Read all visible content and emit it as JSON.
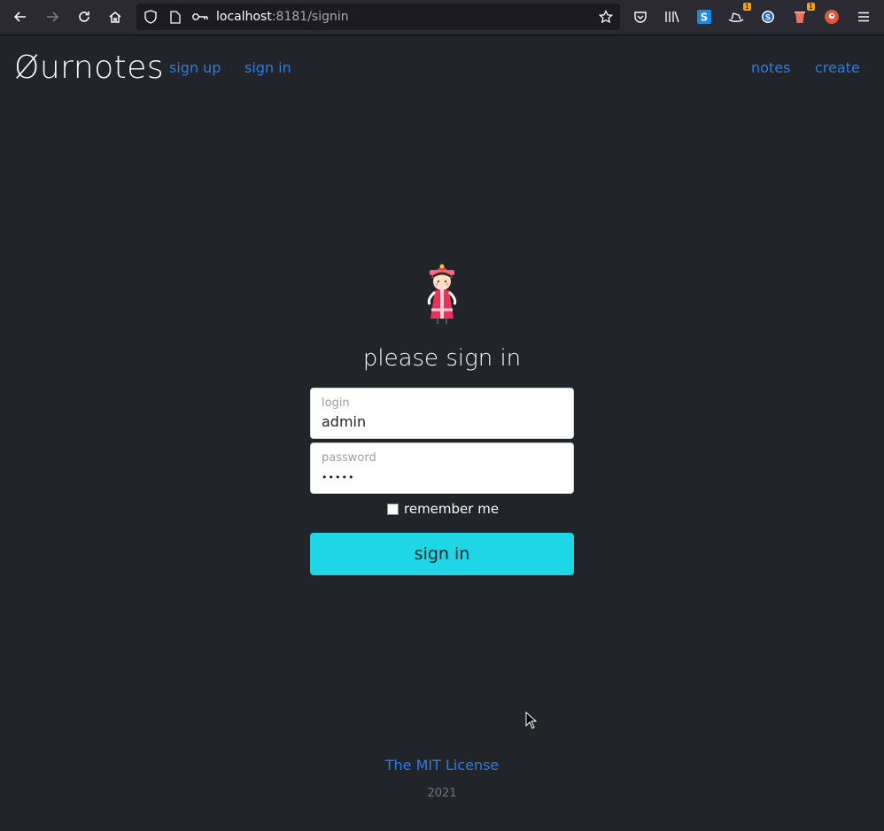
{
  "browser": {
    "url_host": "localhost",
    "url_rest": ":8181/signin",
    "toolbar_icons": [
      "back-arrow-icon",
      "forward-arrow-icon",
      "reload-icon",
      "home-icon",
      "shield-icon",
      "page-icon",
      "key-icon",
      "bookmark-star-icon",
      "pocket-icon",
      "library-icon",
      "extension-s-icon",
      "extension-hat-icon",
      "extension-circle-s-icon",
      "extension-cup-icon",
      "duckduckgo-icon",
      "menu-icon"
    ],
    "badges": [
      "1",
      "1"
    ]
  },
  "header": {
    "brand": "Øurnotes",
    "nav_left": [
      "sign up",
      "sign in"
    ],
    "nav_right": [
      "notes",
      "create"
    ]
  },
  "form": {
    "heading": "please sign in",
    "login_label": "login",
    "login_value": "admin",
    "password_label": "password",
    "password_value": "•••••",
    "remember_label": "remember me",
    "remember_checked": false,
    "submit_label": "sign in"
  },
  "footer": {
    "license": "The MIT License",
    "year": "2021"
  },
  "colors": {
    "background": "#212529",
    "link": "#2c7be5",
    "button": "#1ed6e6"
  }
}
